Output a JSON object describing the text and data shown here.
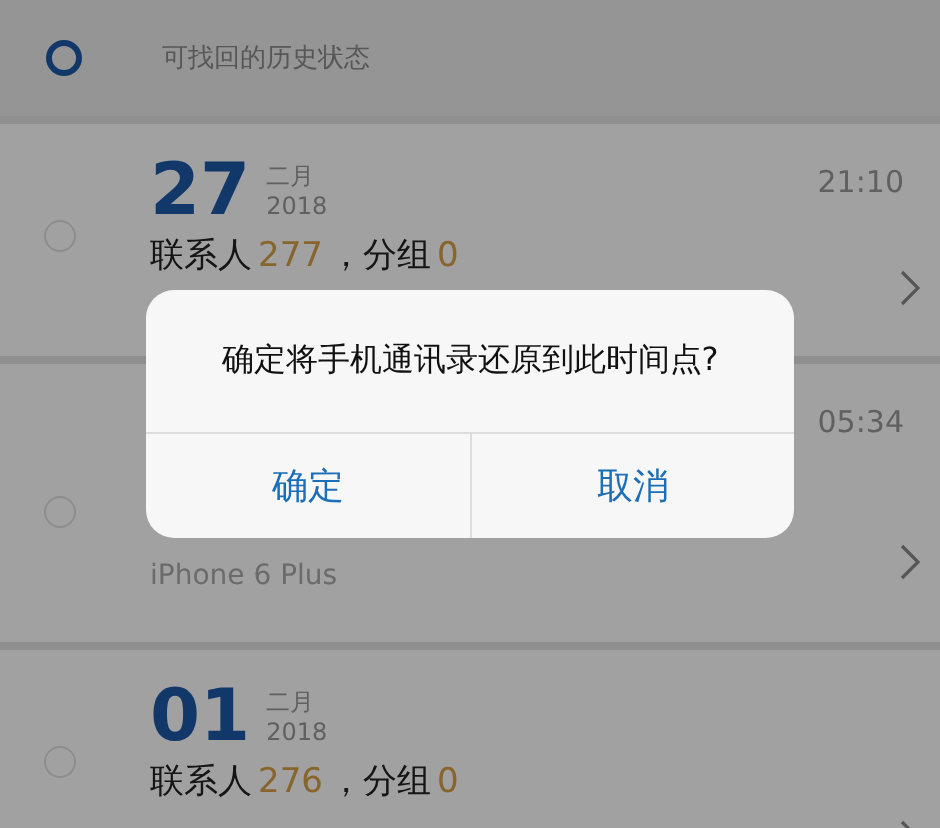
{
  "header": {
    "label": "可找回的历史状态"
  },
  "entries": [
    {
      "day": "27",
      "month": "二月",
      "year": "2018",
      "time": "21:10",
      "contacts_label": "联系人",
      "contacts_count": "277",
      "groups_label": "，分组",
      "groups_count": "0"
    },
    {
      "time": "05:34",
      "device": "iPhone 6 Plus"
    },
    {
      "day": "01",
      "month": "二月",
      "year": "2018",
      "contacts_label": "联系人",
      "contacts_count": "276",
      "groups_label": "，分组",
      "groups_count": "0"
    }
  ],
  "dialog": {
    "message": "确定将手机通讯录还原到此时间点?",
    "buttons": [
      "确定",
      "取消"
    ]
  }
}
